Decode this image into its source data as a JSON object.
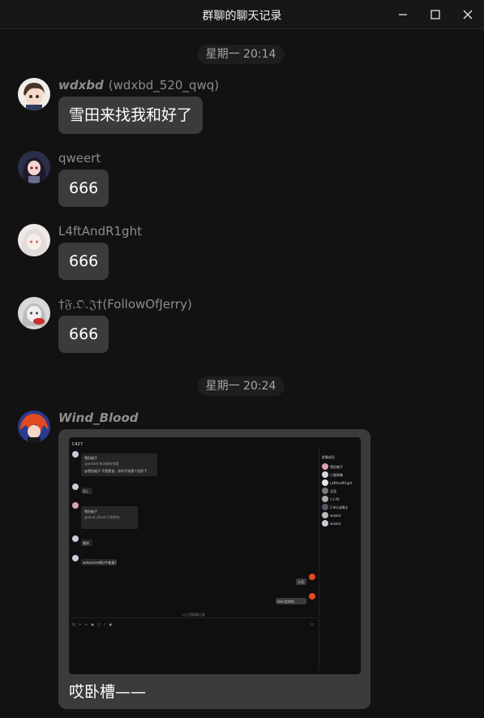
{
  "window": {
    "title": "群聊的聊天记录",
    "minimize_icon": "minimize-icon",
    "maximize_icon": "maximize-icon",
    "close_icon": "close-icon"
  },
  "timestamps": [
    "星期一 20:14",
    "星期一 20:24"
  ],
  "messages": [
    {
      "name": "wdxbd",
      "uid": "(wdxbd_520_qwq)",
      "text": "雪田来找我和好了",
      "avatar": "anime-avatar-brown-hair"
    },
    {
      "name": "qweert",
      "text": "666",
      "avatar": "anime-avatar-dark-hair"
    },
    {
      "name": "L4ftAndR1ght",
      "text": "666",
      "avatar": "anime-avatar-white-hair"
    },
    {
      "name": "†𝔉.𝔒.𝔍†(FollowOfJerry)",
      "text": "666",
      "avatar": "anime-avatar-grey-sticker"
    },
    {
      "name": "Wind_Blood",
      "text": "哎卧槽——",
      "avatar": "anime-avatar-red-hair",
      "has_image": true
    }
  ],
  "embedded_screenshot": {
    "header": "C427",
    "reply1_title": "雪田喵子",
    "reply1_body": "@wdxbd 每次都有惊喜",
    "reply1_text": "@雪田喵子 不是我说，你好歹给我个台阶下",
    "msg_short1": "同上",
    "reply2_title": "雪田喵子",
    "reply2_body": "@wind_blood 行吧你先",
    "msg_short2": "删除",
    "msg_q": "wdxseirer喝红牛能量?",
    "right_msg1": "卡死",
    "right_msg2": "dmc信你的",
    "input_hint": "以上是群聊记录",
    "sidebar_title": "群聊成员",
    "sidebar_items": [
      "雪田喵子",
      "小猫咪嘞",
      "L4ftAndR1ght",
      "北昆",
      "†.2.9†",
      "2.8行动喝水",
      "wdxbd",
      "wdxbd"
    ]
  }
}
